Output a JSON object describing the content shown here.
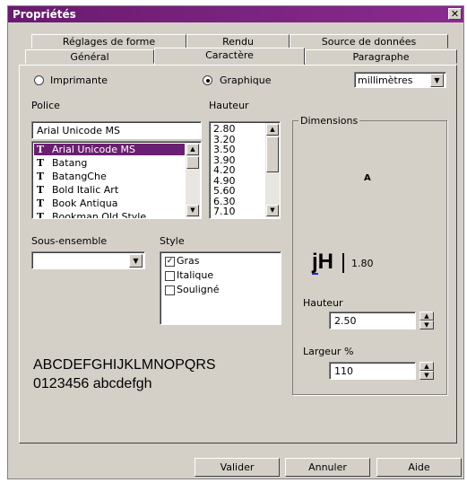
{
  "window": {
    "title": "Propriétés",
    "close_symbol": "✕"
  },
  "tabs": {
    "row1": [
      "Réglages de forme",
      "Rendu",
      "Source de données"
    ],
    "row2": [
      "Général",
      "Caractère",
      "Paragraphe"
    ]
  },
  "output": {
    "printer_label": "Imprimante",
    "graphic_label": "Graphique",
    "selected": "Graphique",
    "units_value": "millimètres"
  },
  "font": {
    "label": "Police",
    "current": "Arial Unicode MS",
    "items": [
      "Arial Unicode MS",
      "Batang",
      "BatangChe",
      "Bold Italic Art",
      "Book Antiqua",
      "Bookman Old Style"
    ],
    "selected_index": 0
  },
  "height_list": {
    "label": "Hauteur",
    "items": [
      "2.80",
      "3.20",
      "3.50",
      "3.90",
      "4.20",
      "4.90",
      "5.60",
      "6.30",
      "7.10"
    ]
  },
  "subset": {
    "label": "Sous-ensemble",
    "value": ""
  },
  "style": {
    "label": "Style",
    "options": [
      {
        "label": "Gras",
        "checked": true
      },
      {
        "label": "Italique",
        "checked": false
      },
      {
        "label": "Souligné",
        "checked": false
      }
    ]
  },
  "preview": {
    "line1": "ABCDEFGHIJKLMNOPQRS",
    "line2": "0123456 abcdefgh"
  },
  "dimensions": {
    "legend": "Dimensions",
    "sample_char": "A",
    "sample_text": "jH",
    "size_readout": "1.80",
    "height_label": "Hauteur",
    "height_value": "2.50",
    "width_label": "Largeur %",
    "width_value": "110"
  },
  "buttons": {
    "ok": "Valider",
    "cancel": "Annuler",
    "help": "Aide"
  },
  "colors": {
    "title_bar": "#6a1a6f",
    "selection": "#6b1f71",
    "face": "#d4d0c8"
  }
}
